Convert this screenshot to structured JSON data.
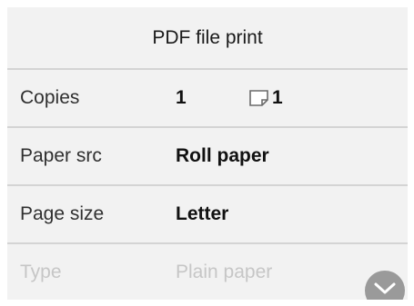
{
  "header": {
    "title": "PDF file print"
  },
  "rows": [
    {
      "label": "Copies",
      "value": "1",
      "sheets": "1"
    },
    {
      "label": "Paper src",
      "value": "Roll paper"
    },
    {
      "label": "Page size",
      "value": "Letter"
    },
    {
      "label": "Type",
      "value": "Plain paper",
      "disabled": true
    }
  ],
  "icons": {
    "sheet": "sheet-icon",
    "scroll": "chevron-down-icon"
  },
  "colors": {
    "background": "#ececec",
    "divider": "#d4d4d4",
    "disabled_text": "#c6c6c6",
    "scroll_button": "#9a9a9a"
  }
}
